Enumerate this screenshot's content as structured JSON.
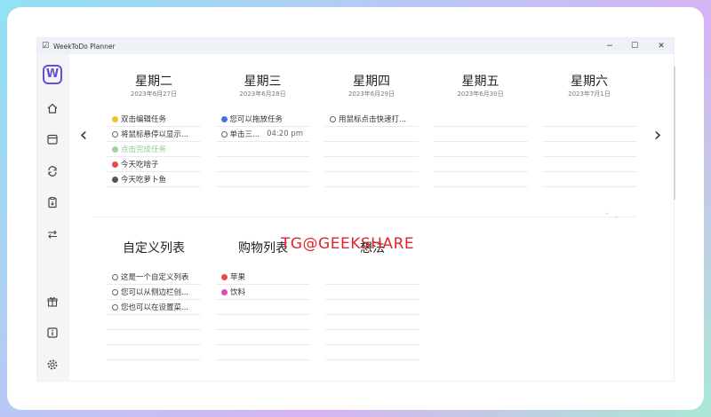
{
  "window": {
    "title": "WeekToDo Planner",
    "minimize": "−",
    "maximize": "☐",
    "close": "✕"
  },
  "sidebar": {
    "logo": "W",
    "icons": [
      "home-icon",
      "calendar-icon",
      "sync-icon",
      "clipboard-icon",
      "swap-icon",
      "gift-icon",
      "info-icon",
      "settings-icon"
    ]
  },
  "nav": {
    "prev": "‹",
    "next": "›"
  },
  "days": [
    {
      "name": "星期二",
      "date": "2023年6月27日",
      "tasks": [
        {
          "text": "双击编辑任务",
          "color": "#f2c12e",
          "style": "filled"
        },
        {
          "text": "将鼠标悬停以显示...",
          "color": "#666666",
          "style": "hollow"
        },
        {
          "text": "点击完成任务",
          "color": "#9bd39b",
          "style": "done"
        },
        {
          "text": "今天吃啥子",
          "color": "#e84a4a",
          "style": "filled"
        },
        {
          "text": "今天吃萝卜鱼",
          "color": "#555555",
          "style": "filled"
        }
      ]
    },
    {
      "name": "星期三",
      "date": "2023年6月28日",
      "tasks": [
        {
          "text": "您可以拖放任务",
          "color": "#4a6ee0",
          "style": "filled"
        },
        {
          "text": "单击三...",
          "time": "04:20 pm",
          "color": "#666666",
          "style": "hollow"
        }
      ]
    },
    {
      "name": "星期四",
      "date": "2023年6月29日",
      "tasks": [
        {
          "text": "用鼠标点击快速打...",
          "color": "#666666",
          "style": "hollow"
        }
      ]
    },
    {
      "name": "星期五",
      "date": "2023年6月30日",
      "tasks": []
    },
    {
      "name": "星期六",
      "date": "2023年7月1日",
      "tasks": []
    }
  ],
  "lists": [
    {
      "name": "自定义列表",
      "items": [
        {
          "text": "这是一个自定义列表",
          "color": "#666666",
          "style": "hollow"
        },
        {
          "text": "您可以从侧边栏创...",
          "color": "#666666",
          "style": "hollow"
        },
        {
          "text": "您也可以在设置菜...",
          "color": "#666666",
          "style": "hollow"
        }
      ]
    },
    {
      "name": "购物列表",
      "items": [
        {
          "text": "苹果",
          "color": "#e84a4a",
          "style": "filled"
        },
        {
          "text": "饮料",
          "color": "#d94fb0",
          "style": "filled"
        }
      ]
    },
    {
      "name": "想法",
      "items": []
    }
  ],
  "watermark": "TG@GEEKSHARE",
  "collapse": "⌃ ⌄"
}
